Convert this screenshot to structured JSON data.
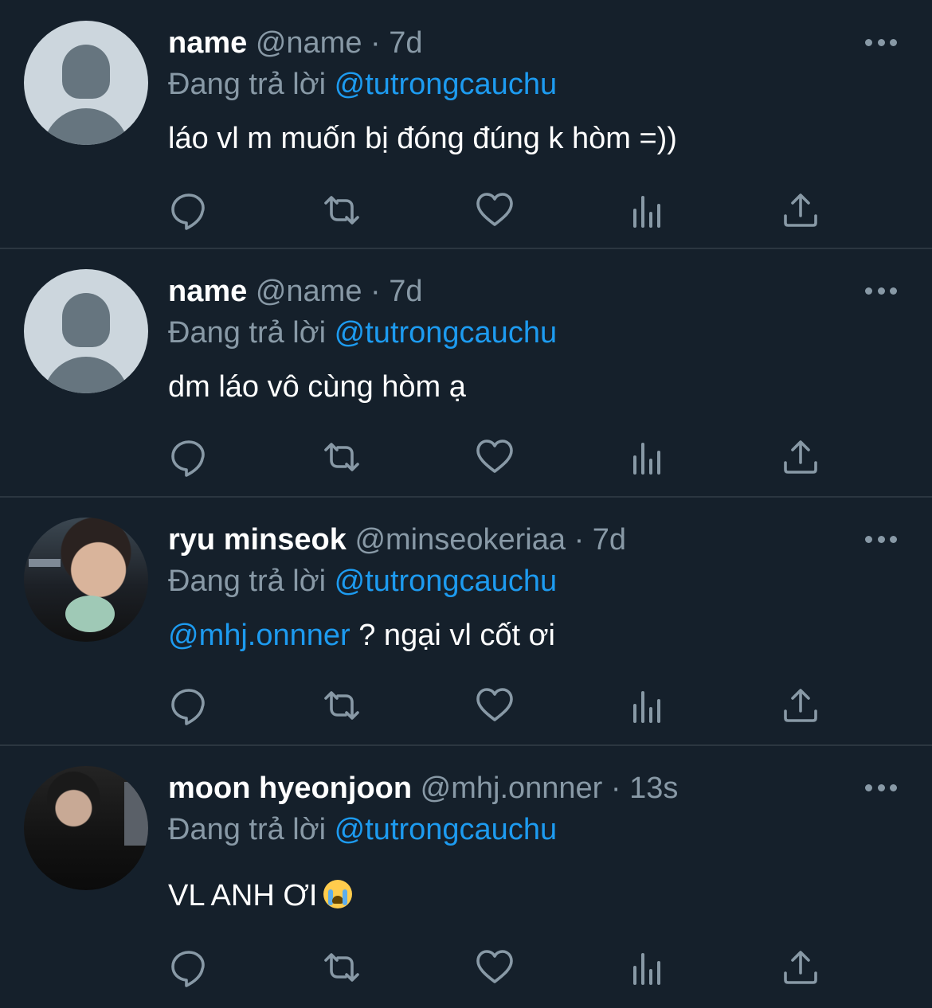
{
  "tweets": [
    {
      "name": "name",
      "handle": "@name",
      "dot": "·",
      "time": "7d",
      "reply_prefix": "Đang trả lời",
      "reply_to": "@tutrongcauchu",
      "mention": "",
      "text": "láo vl m muốn bị đóng đúng k hòm =))",
      "avatar": "default-avatar"
    },
    {
      "name": "name",
      "handle": "@name",
      "dot": "·",
      "time": "7d",
      "reply_prefix": "Đang trả lời",
      "reply_to": "@tutrongcauchu",
      "mention": "",
      "text": "dm láo vô cùng hòm ạ",
      "avatar": "default-avatar"
    },
    {
      "name": "ryu minseok",
      "handle": "@minseokeriaa",
      "dot": "·",
      "time": "7d",
      "reply_prefix": "Đang trả lời",
      "reply_to": "@tutrongcauchu",
      "mention": "@mhj.onnner",
      "text": " ? ngại vl cốt ơi",
      "avatar": "photo-avatar"
    },
    {
      "name": "moon hyeonjoon",
      "handle": "@mhj.onnner",
      "dot": "·",
      "time": "13s",
      "reply_prefix": "Đang trả lời",
      "reply_to": "@tutrongcauchu",
      "mention": "",
      "text": "VL ANH ƠI",
      "emoji": "loudly-crying-face",
      "avatar": "photo-avatar"
    }
  ],
  "action_icons": [
    "reply-icon",
    "retweet-icon",
    "like-icon",
    "analytics-icon",
    "share-icon"
  ],
  "more_icon": "more-options-icon",
  "colors": {
    "background": "#15202b",
    "divider": "#2b3640",
    "text_primary": "#ffffff",
    "text_secondary": "#8899a6",
    "accent": "#1d9bf0"
  }
}
